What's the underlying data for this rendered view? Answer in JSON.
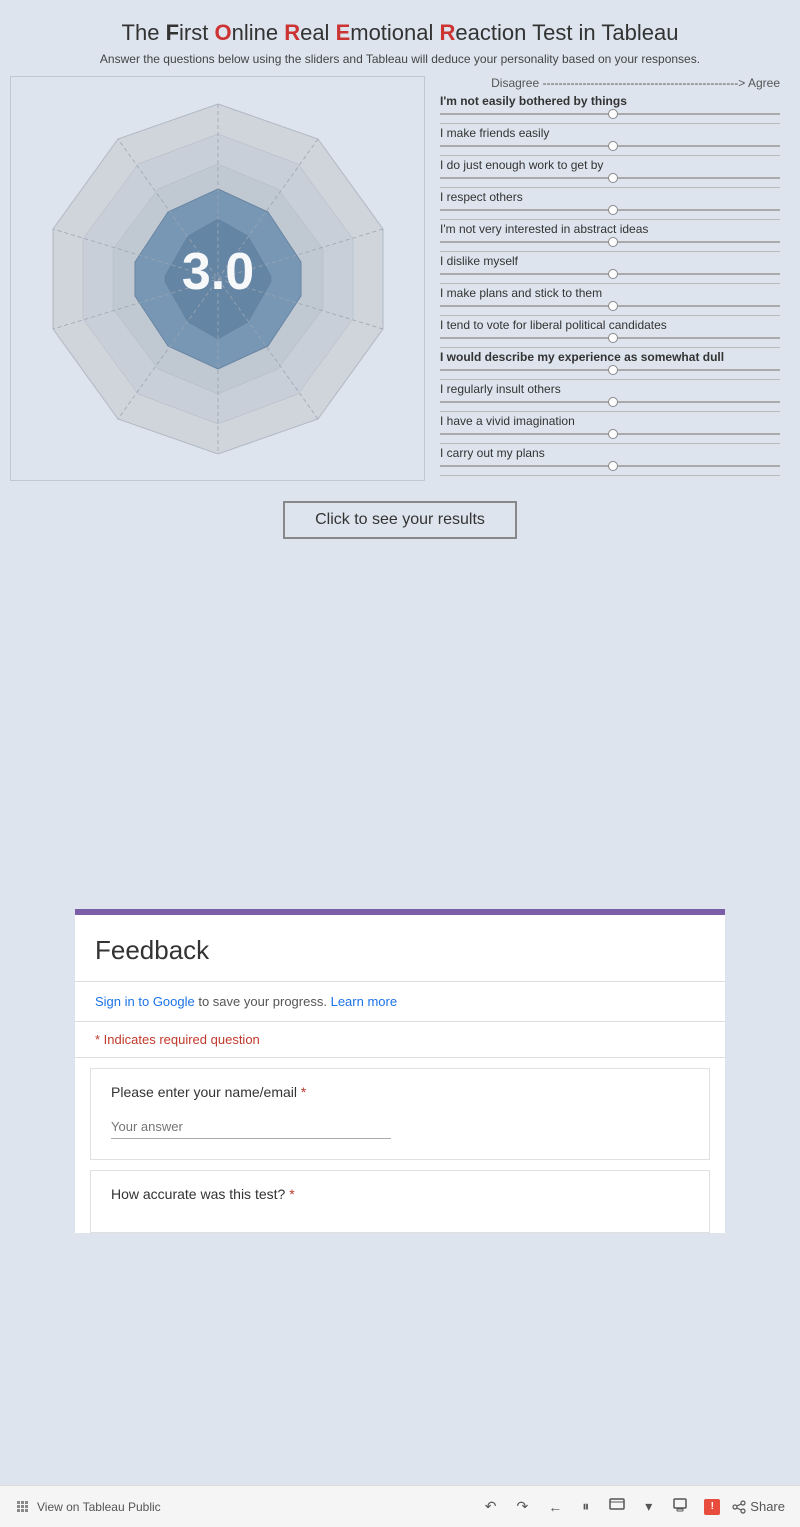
{
  "header": {
    "title_parts": [
      {
        "text": "The ",
        "style": "normal"
      },
      {
        "text": "F",
        "style": "bold"
      },
      {
        "text": "irst ",
        "style": "normal"
      },
      {
        "text": "O",
        "style": "red"
      },
      {
        "text": "nline ",
        "style": "normal"
      },
      {
        "text": "R",
        "style": "red"
      },
      {
        "text": "eal ",
        "style": "normal"
      },
      {
        "text": "E",
        "style": "red"
      },
      {
        "text": "motional ",
        "style": "normal"
      },
      {
        "text": "R",
        "style": "red"
      },
      {
        "text": "eaction Test in Tableau",
        "style": "normal"
      }
    ],
    "title_display": "The First Online Real Emotional Reaction Test in Tableau",
    "subtitle": "Answer the questions below using the sliders and Tableau will deduce your personality based on your responses."
  },
  "scale_label": "Disagree -------------------------------------------------> Agree",
  "radar_value": "3.0",
  "questions": [
    {
      "label": "I'm not easily bothered by things",
      "bold": true,
      "thumb_pct": 51
    },
    {
      "label": "I make friends easily",
      "bold": false,
      "thumb_pct": 51
    },
    {
      "label": "I do just enough work to get by",
      "bold": false,
      "thumb_pct": 51
    },
    {
      "label": "I respect others",
      "bold": false,
      "thumb_pct": 51
    },
    {
      "label": "I'm not very interested in abstract ideas",
      "bold": false,
      "thumb_pct": 51
    },
    {
      "label": "I dislike myself",
      "bold": false,
      "thumb_pct": 51
    },
    {
      "label": "I make plans and stick to them",
      "bold": false,
      "thumb_pct": 51
    },
    {
      "label": "I tend to vote for liberal political candidates",
      "bold": false,
      "thumb_pct": 51
    },
    {
      "label": "I would describe my experience as somewhat dull",
      "bold": true,
      "thumb_pct": 51
    },
    {
      "label": "I regularly insult others",
      "bold": false,
      "thumb_pct": 51
    },
    {
      "label": "I have a vivid imagination",
      "bold": false,
      "thumb_pct": 51
    },
    {
      "label": "I carry out my plans",
      "bold": false,
      "thumb_pct": 51
    }
  ],
  "results_button": "Click to see your results",
  "feedback": {
    "title": "Feedback",
    "signin_text": "Sign in to Google",
    "signin_suffix": " to save your progress.",
    "learn_more": "Learn more",
    "required_note": "* Indicates required question",
    "question1_label": "Please enter your name/email",
    "question1_required": "*",
    "question1_placeholder": "Your answer",
    "question2_label": "How accurate was this test?",
    "question2_required": "*"
  },
  "toolbar": {
    "view_label": "View on Tableau Public",
    "share_label": "Share",
    "notification_badge": "!"
  },
  "colors": {
    "accent": "#7b5ea7",
    "radar_fill": "#6b8faf",
    "background": "#dde4ed"
  }
}
